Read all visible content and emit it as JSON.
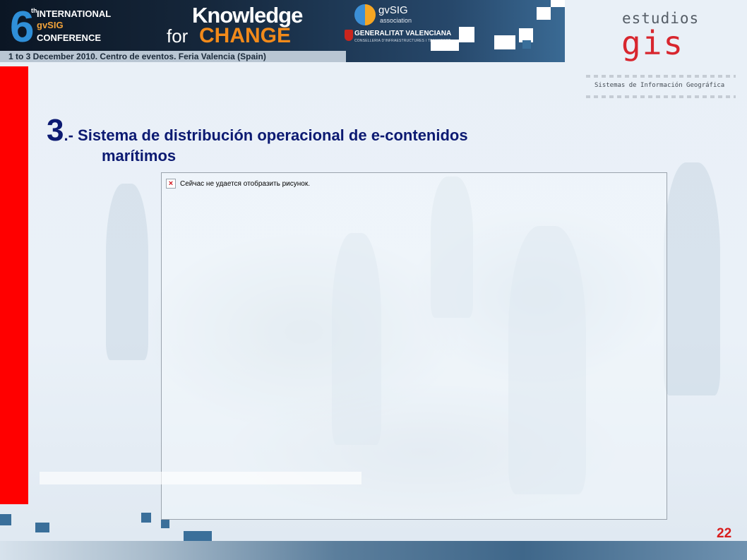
{
  "banner": {
    "conference_number": "6",
    "conference_suffix": "th",
    "conference_line1": "INTERNATIONAL",
    "conference_line2": "gvSIG",
    "conference_line3": "CONFERENCE",
    "date_location": "1 to 3 December 2010. Centro de eventos. Feria Valencia (Spain)",
    "slogan_part1": "Knowledge",
    "slogan_part2a": "for",
    "slogan_part2b": "CHANGE",
    "gvsig_name": "gvSIG",
    "gvsig_assoc": "association",
    "gva_name": "GENERALITAT VALENCIANA",
    "gva_sub": "CONSELLERIA D'INFRAESTRUCTURES I TRANSPORT"
  },
  "logo": {
    "estudios": "estudios",
    "gis": "gis",
    "subtitle": "Sistemas de Información Geográfica"
  },
  "slide": {
    "title_number": "3",
    "title_line1": ".- Sistema de distribución operacional de e-contenidos",
    "title_line2": "marítimos",
    "image_error": "Сейчас не удается отобразить рисунок.",
    "page_number": "22"
  },
  "colors": {
    "title": "#0c1a72",
    "accent_red": "#ff0000",
    "page_number": "#d81d1d",
    "gis_red": "#d8262e"
  }
}
